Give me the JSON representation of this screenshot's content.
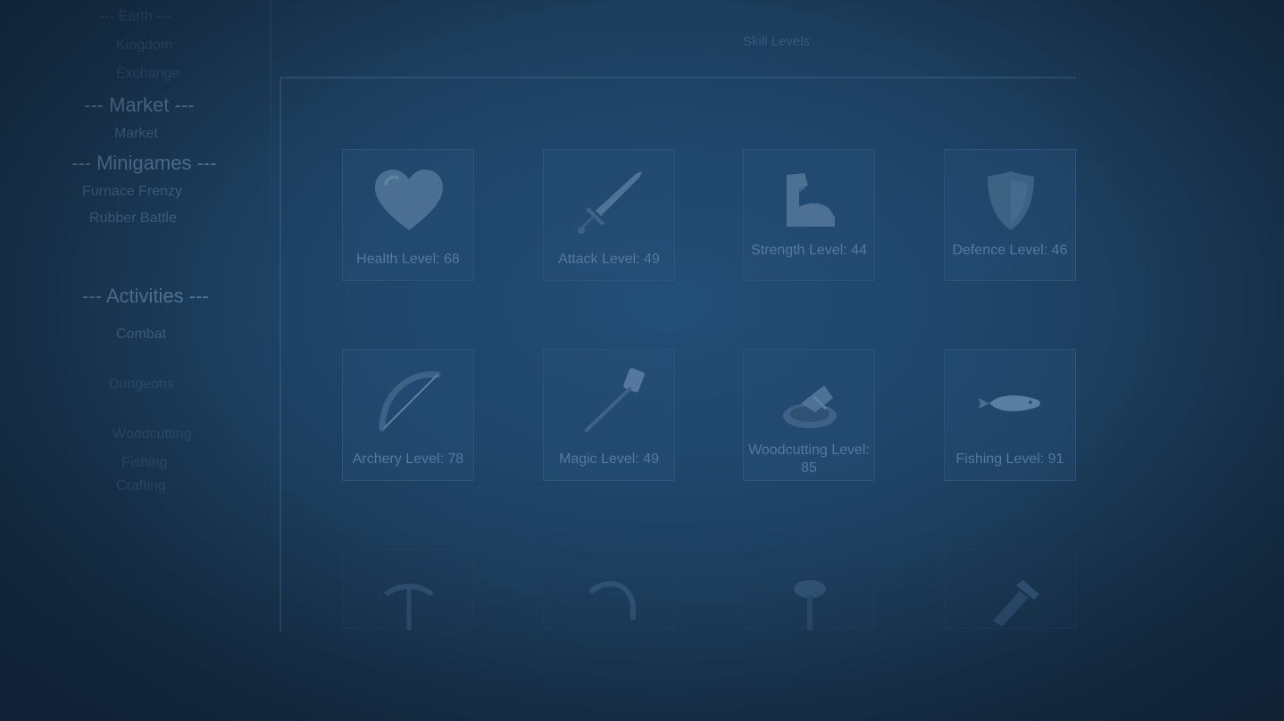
{
  "sidebar": {
    "items_top": [
      {
        "label": "--- Earth ---"
      },
      {
        "label": "Kingdom"
      },
      {
        "label": "Exchange"
      }
    ],
    "market_header": "--- Market ---",
    "market_items": [
      "Market"
    ],
    "minigames_header": "--- Minigames ---",
    "minigames_items": [
      "Furnace Frenzy",
      "Rubber Battle"
    ],
    "activities_header": "--- Activities ---",
    "activities_items": [
      "Combat",
      "Dungeons",
      "Woodcutting",
      "Fishing",
      "Crafting"
    ]
  },
  "header": {
    "title": "Skill Levels"
  },
  "skills": [
    {
      "name": "Health",
      "label": "Health Level: 68",
      "icon": "heart-icon",
      "level": 68
    },
    {
      "name": "Attack",
      "label": "Attack Level: 49",
      "icon": "sword-icon",
      "level": 49
    },
    {
      "name": "Strength",
      "label": "Strength Level: 44",
      "icon": "flexed-arm-icon",
      "level": 44
    },
    {
      "name": "Defence",
      "label": "Defence Level: 46",
      "icon": "shield-icon",
      "level": 46
    },
    {
      "name": "Archery",
      "label": "Archery Level: 78",
      "icon": "bow-icon",
      "level": 78
    },
    {
      "name": "Magic",
      "label": "Magic Level: 49",
      "icon": "magic-wand-icon",
      "level": 49
    },
    {
      "name": "Woodcutting",
      "label": "Woodcutting Level: 85",
      "icon": "axe-icon",
      "level": 85
    },
    {
      "name": "Fishing",
      "label": "Fishing Level: 91",
      "icon": "fish-icon",
      "level": 91
    }
  ],
  "faded_row_icons": [
    "pickaxe-icon",
    "hook-icon",
    "mushroom-icon",
    "hammer-icon"
  ],
  "colors": {
    "background": "#1f4569",
    "card_border": "#2d5478",
    "text": "#55799c"
  }
}
